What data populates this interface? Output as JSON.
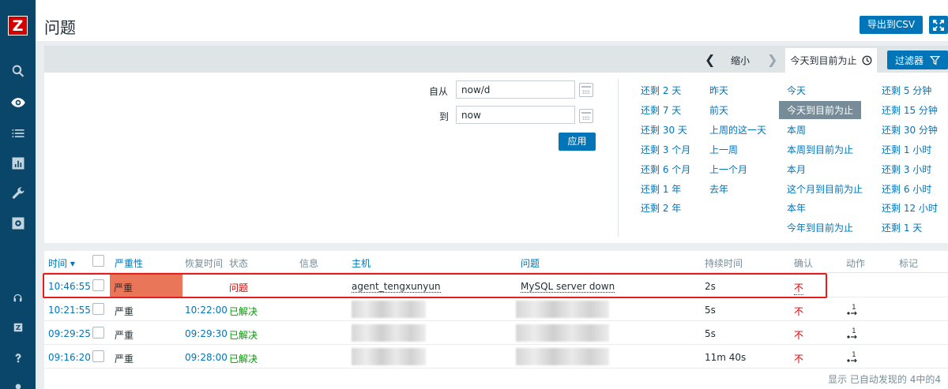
{
  "app": {
    "logo_letter": "Z"
  },
  "header": {
    "title": "问题",
    "export_label": "导出到CSV"
  },
  "filter_bar": {
    "zoom_out": "缩小",
    "active_tab": "今天到目前为止",
    "filter_label": "过滤器"
  },
  "filter_panel": {
    "from_label": "自从",
    "from_value": "now/d",
    "to_label": "到",
    "to_value": "now",
    "apply_label": "应用",
    "quick_col1": [
      "还剩 2 天",
      "还剩 7 天",
      "还剩 30 天",
      "还剩 3 个月",
      "还剩 6 个月",
      "还剩 1 年",
      "还剩 2 年"
    ],
    "quick_col2": [
      "昨天",
      "前天",
      "上周的这一天",
      "上一周",
      "上一个月",
      "去年"
    ],
    "quick_col3": [
      "今天",
      "今天到目前为止",
      "本周",
      "本周到目前为止",
      "本月",
      "这个月到目前为止",
      "本年",
      "今年到目前为止"
    ],
    "quick_col4": [
      "还剩 5 分钟",
      "还剩 15 分钟",
      "还剩 30 分钟",
      "还剩 1 小时",
      "还剩 3 小时",
      "还剩 6 小时",
      "还剩 12 小时",
      "还剩 1 天"
    ]
  },
  "table": {
    "headers": {
      "time": "时间 ▾",
      "severity": "严重性",
      "recovery": "恢复时间",
      "status": "状态",
      "info": "信息",
      "host": "主机",
      "problem": "问题",
      "duration": "持续时间",
      "ack": "确认",
      "actions": "动作",
      "tags": "标记"
    },
    "rows": [
      {
        "time": "10:46:55",
        "severity": "严重",
        "recovery": "",
        "status": "问题",
        "host": "agent_tengxunyun",
        "problem": "MySQL server down",
        "duration": "2s",
        "ack": "不"
      },
      {
        "time": "10:21:55",
        "severity": "严重",
        "recovery": "10:22:00",
        "status": "已解决",
        "host": "",
        "problem": "",
        "duration": "5s",
        "ack": "不"
      },
      {
        "time": "09:29:25",
        "severity": "严重",
        "recovery": "09:29:30",
        "status": "已解决",
        "host": "",
        "problem": "",
        "duration": "5s",
        "ack": "不"
      },
      {
        "time": "09:16:20",
        "severity": "严重",
        "recovery": "09:28:00",
        "status": "已解决",
        "host": "",
        "problem": "",
        "duration": "11m 40s",
        "ack": "不"
      }
    ],
    "action_count": "1",
    "footer": "显示 已自动发现的 4中的4"
  },
  "colors": {
    "sidebar": "#0a466a",
    "accent": "#0275b8",
    "severity_high": "#e97659",
    "problem": "#dc0000",
    "resolved": "#009900"
  }
}
